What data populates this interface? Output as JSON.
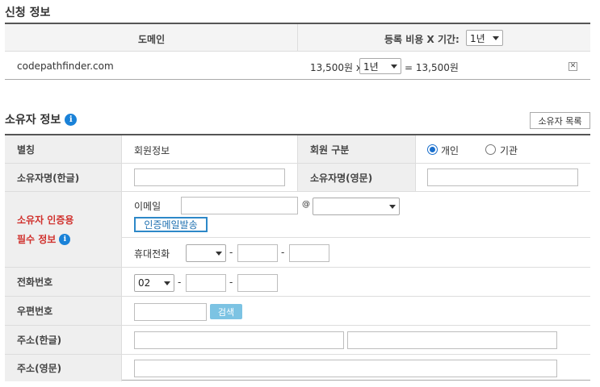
{
  "sections": {
    "apply_title": "신청 정보",
    "owner_title": "소유자 정보"
  },
  "apply_table": {
    "col_domain": "도메인",
    "col_fee": "등록 비용 X 기간:",
    "period_select": "1년",
    "domain": "codepathfinder.com",
    "price": "13,500원 x",
    "row_period": "1년",
    "total": "= 13,500원"
  },
  "owner": {
    "list_button": "소유자 목록",
    "alias_label": "별칭",
    "alias_value": "회원정보",
    "member_type_label": "회원 구분",
    "radio_personal": "개인",
    "radio_org": "기관",
    "name_kr_label": "소유자명(한글)",
    "name_en_label": "소유자명(영문)",
    "auth_label_line1": "소유자 인증용",
    "auth_label_line2": "필수 정보",
    "email_label": "이메일",
    "at_sign": "@",
    "auth_button": "인증메일발송",
    "mobile_label": "휴대전화",
    "phone_label": "전화번호",
    "phone_prefix": "02",
    "dash": "-",
    "zip_label": "우편번호",
    "search_button": "검색",
    "addr_kr_label": "주소(한글)",
    "addr_en_label": "주소(영문)"
  },
  "colors": {
    "accent_red": "#d0312d",
    "info_blue": "#1a82d8",
    "search_btn": "#7cc3e3"
  }
}
